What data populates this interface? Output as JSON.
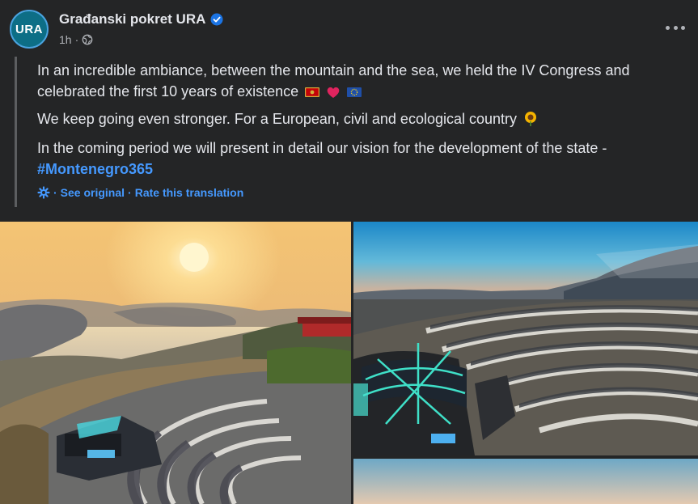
{
  "post": {
    "author": "Građanski pokret URA",
    "avatar_text": "URA",
    "time": "1h",
    "separator": "·"
  },
  "icons": {
    "verified": "verified-badge-icon",
    "globe": "globe-icon",
    "more": "more-options-icon",
    "translate": "translate-gear-icon",
    "flags": [
      "montenegro-flag-icon",
      "red-heart-icon",
      "eu-flag-icon"
    ],
    "sunflower": "sunflower-icon"
  },
  "translation": {
    "p1": "In an incredible ambiance, between the mountain and the sea, we held the IV Congress and celebrated the first 10 years of existence",
    "p2": "We keep going even stronger. For a European, civil and ecological country",
    "p3": "In the coming period we will present in detail our vision for the development of the state -",
    "hashtag": "#Montenegro365",
    "see_original": "See original",
    "rate": "Rate this translation",
    "dot": "·"
  },
  "colors": {
    "background": "#242526",
    "text": "#e4e6eb",
    "secondary": "#b0b3b8",
    "link": "#4599ff",
    "verified": "#1b74e4"
  }
}
